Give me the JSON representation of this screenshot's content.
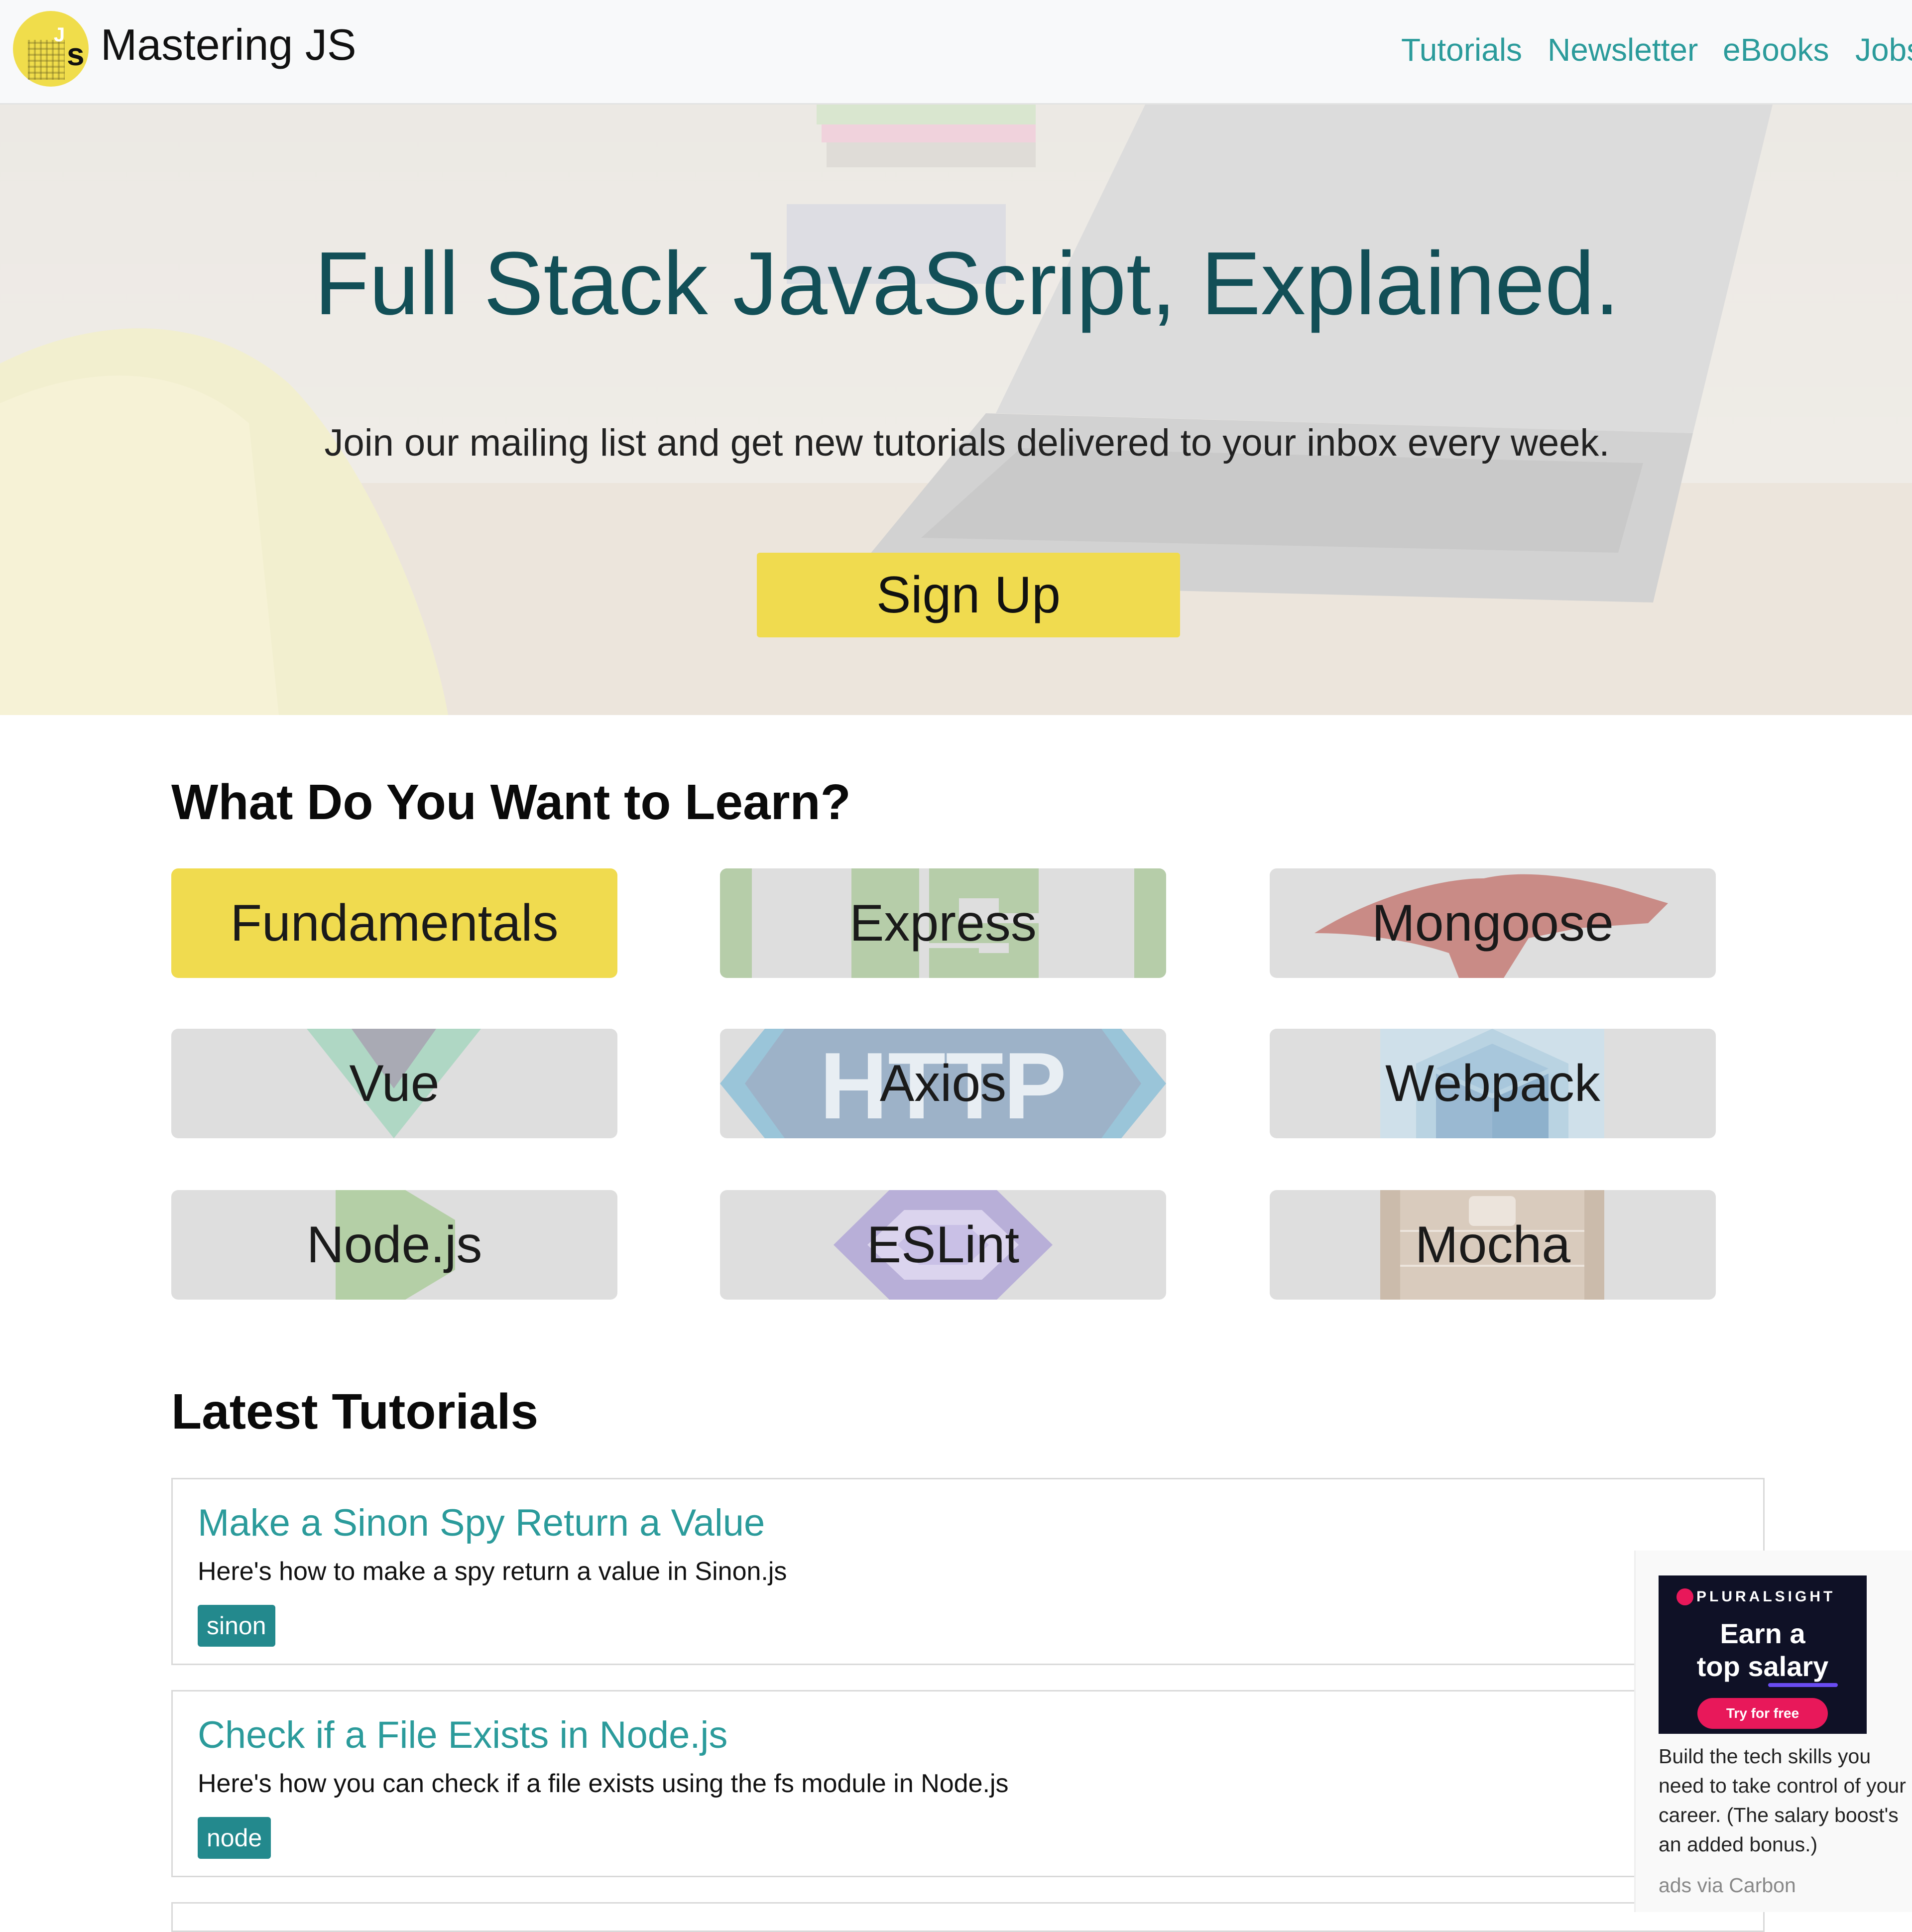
{
  "header": {
    "brand": "Mastering JS",
    "logo_letters": "Js",
    "nav": [
      {
        "label": "Tutorials"
      },
      {
        "label": "Newsletter"
      },
      {
        "label": "eBooks"
      },
      {
        "label": "Jobs"
      }
    ]
  },
  "hero": {
    "title": "Full Stack JavaScript, Explained.",
    "subtitle": "Join our mailing list and get new tutorials delivered to your inbox every week.",
    "cta_label": "Sign Up"
  },
  "learn": {
    "heading": "What Do You Want to Learn?",
    "topics": [
      {
        "label": "Fundamentals",
        "icon": "fundamentals-icon"
      },
      {
        "label": "Express",
        "icon": "express-logo-icon"
      },
      {
        "label": "Mongoose",
        "icon": "mongoose-logo-icon"
      },
      {
        "label": "Vue",
        "icon": "vue-logo-icon"
      },
      {
        "label": "Axios",
        "icon": "axios-http-icon",
        "art_text": "HTTP"
      },
      {
        "label": "Webpack",
        "icon": "webpack-logo-icon"
      },
      {
        "label": "Node.js",
        "icon": "nodejs-logo-icon"
      },
      {
        "label": "ESLint",
        "icon": "eslint-logo-icon"
      },
      {
        "label": "Mocha",
        "icon": "mocha-logo-icon"
      }
    ]
  },
  "latest": {
    "heading": "Latest Tutorials",
    "tutorials": [
      {
        "title": "Make a Sinon Spy Return a Value",
        "description": "Here's how to make a spy return a value in Sinon.js",
        "tag": "sinon"
      },
      {
        "title": "Check if a File Exists in Node.js",
        "description": "Here's how you can check if a file exists using the fs module in Node.js",
        "tag": "node"
      }
    ]
  },
  "ad": {
    "brand": "PLURALSIGHT",
    "headline_line1": "Earn a",
    "headline_line2": "top salary",
    "cta": "Try for free",
    "text": "Build the tech skills you need to take control of your career. (The salary boost's an added bonus.)",
    "via": "ads via Carbon"
  },
  "colors": {
    "accent_teal": "#2b9b9b",
    "js_yellow": "#f0db4f",
    "hero_title": "#124f57",
    "tag_bg": "#23898d"
  }
}
